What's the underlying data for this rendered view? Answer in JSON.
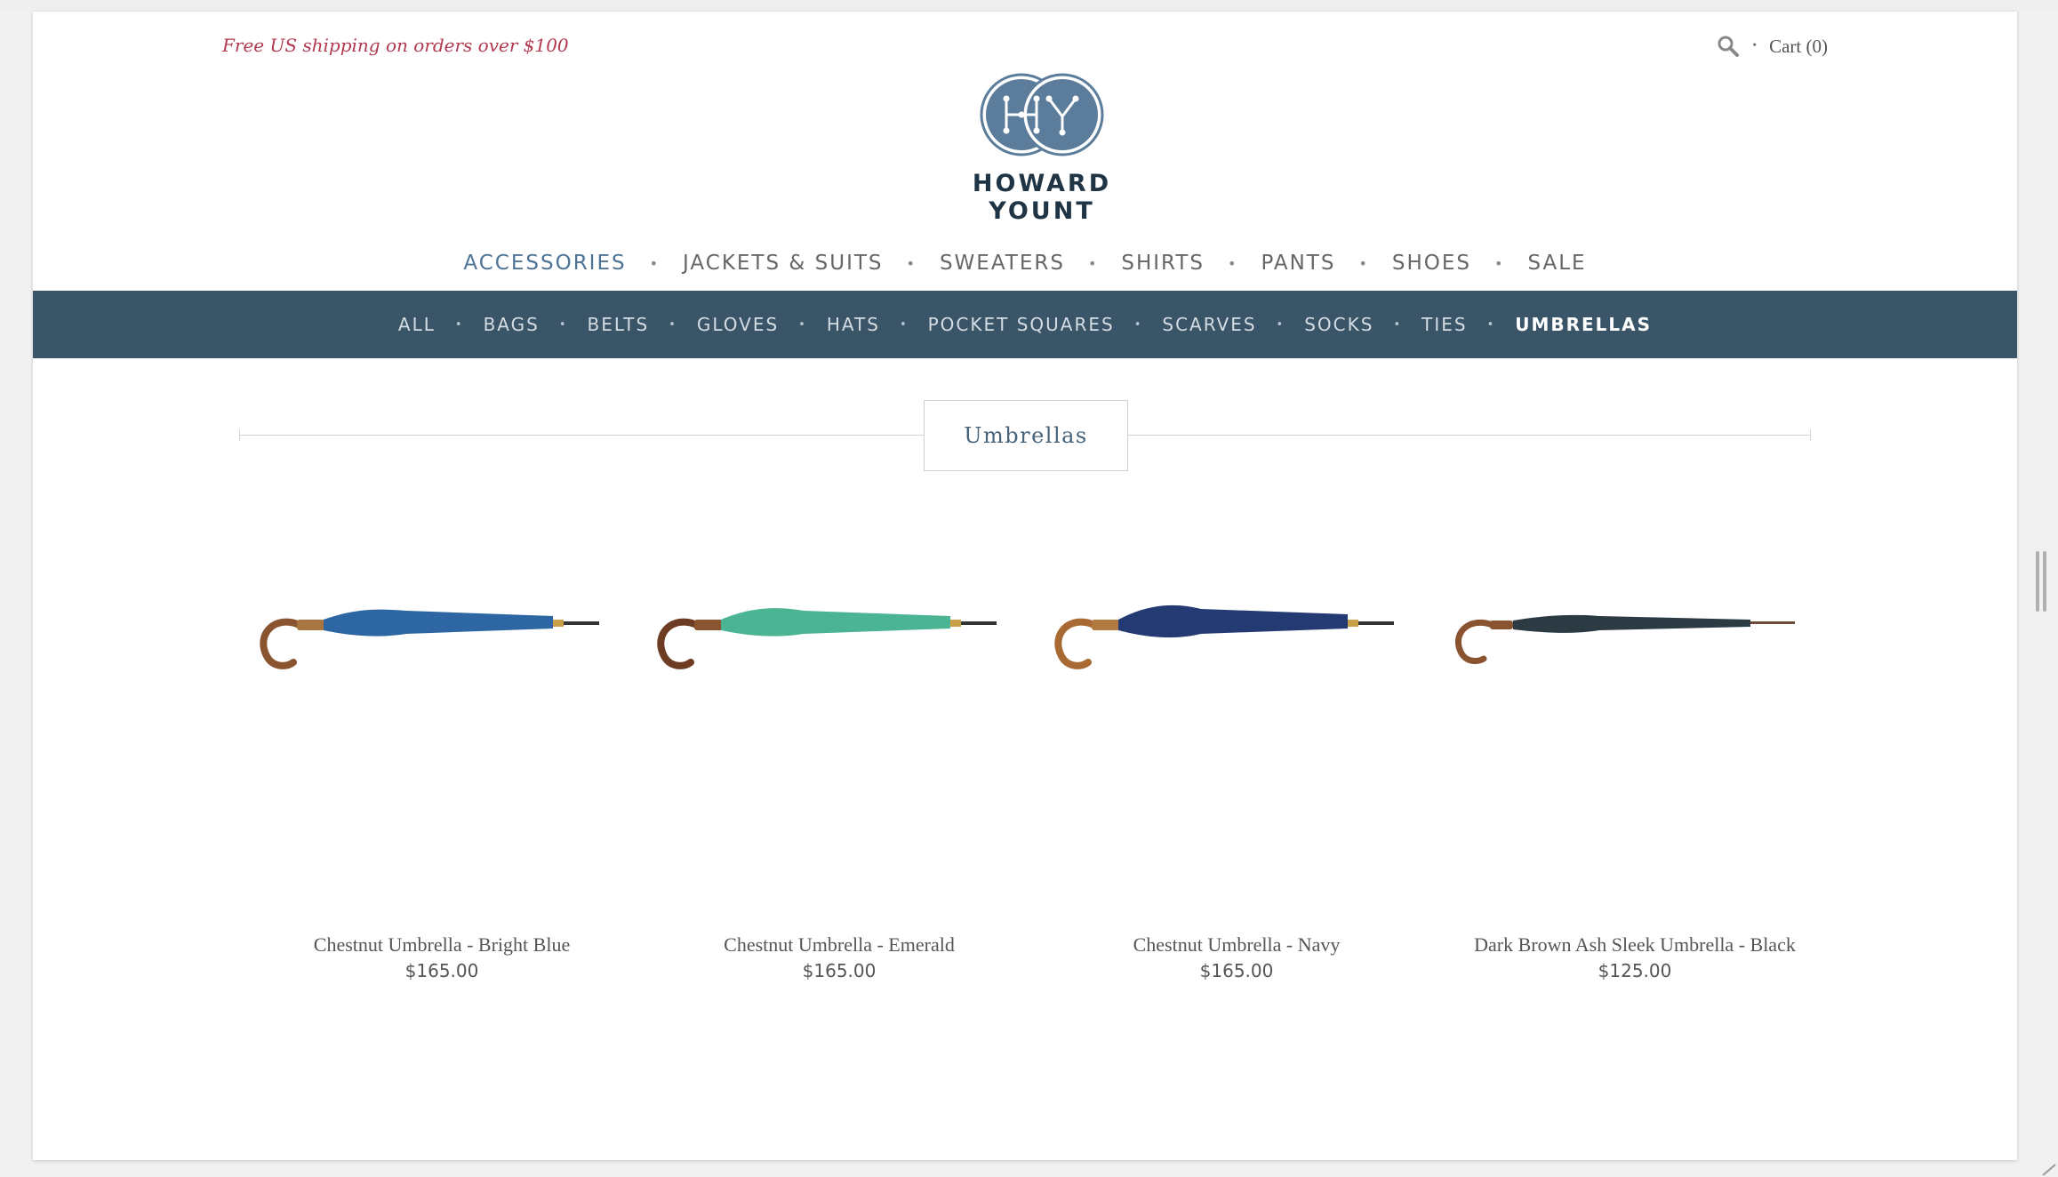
{
  "header": {
    "promo": "Free US shipping on orders over $100",
    "cart_label": "Cart (0)",
    "search_icon": "search-icon",
    "brand": "HOWARD YOUNT",
    "logo_letters": [
      "H",
      "Y"
    ],
    "logo_color": "#5b7d9b"
  },
  "main_nav": [
    {
      "label": "ACCESSORIES",
      "active": true
    },
    {
      "label": "JACKETS & SUITS",
      "active": false
    },
    {
      "label": "SWEATERS",
      "active": false
    },
    {
      "label": "SHIRTS",
      "active": false
    },
    {
      "label": "PANTS",
      "active": false
    },
    {
      "label": "SHOES",
      "active": false
    },
    {
      "label": "SALE",
      "active": false
    }
  ],
  "sub_nav": [
    {
      "label": "ALL",
      "active": false
    },
    {
      "label": "BAGS",
      "active": false
    },
    {
      "label": "BELTS",
      "active": false
    },
    {
      "label": "GLOVES",
      "active": false
    },
    {
      "label": "HATS",
      "active": false
    },
    {
      "label": "POCKET SQUARES",
      "active": false
    },
    {
      "label": "SCARVES",
      "active": false
    },
    {
      "label": "SOCKS",
      "active": false
    },
    {
      "label": "TIES",
      "active": false
    },
    {
      "label": "UMBRELLAS",
      "active": true
    }
  ],
  "collection_title": "Umbrellas",
  "products": [
    {
      "name": "Chestnut Umbrella - Bright Blue",
      "price": "$165.00",
      "canopy_color": "#2d66a3"
    },
    {
      "name": "Chestnut Umbrella - Emerald",
      "price": "$165.00",
      "canopy_color": "#4bb495"
    },
    {
      "name": "Chestnut Umbrella - Navy",
      "price": "$165.00",
      "canopy_color": "#243a73"
    },
    {
      "name": "Dark Brown Ash Sleek Umbrella - Black",
      "price": "$125.00",
      "canopy_color": "#2c3a44"
    }
  ],
  "colors": {
    "promo": "#b2394f",
    "subnav_bg": "#3b5568",
    "active_nav": "#4d7496"
  }
}
